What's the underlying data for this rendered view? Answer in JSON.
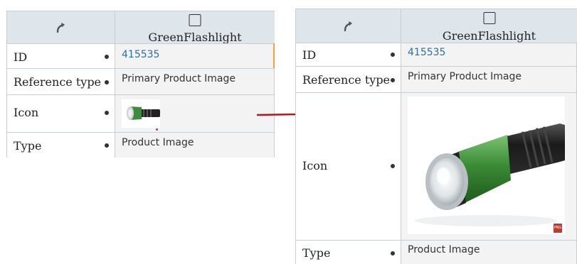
{
  "column": {
    "name": "GreenFlashlight"
  },
  "rows": [
    {
      "label": "ID",
      "value": "415535"
    },
    {
      "label": "Reference type",
      "value": "Primary Product Image"
    },
    {
      "label": "Icon",
      "value": ""
    },
    {
      "label": "Type",
      "value": "Product Image"
    }
  ],
  "icons": {
    "header_left": "refresh-icon",
    "select": "checkbox",
    "file_badge": "png-file-icon"
  },
  "badge_text": "PNG",
  "colors": {
    "header_bg": "#dee6ec",
    "link": "#2e6fa3",
    "arrow": "#a01f24",
    "highlight": "#f0a040"
  }
}
